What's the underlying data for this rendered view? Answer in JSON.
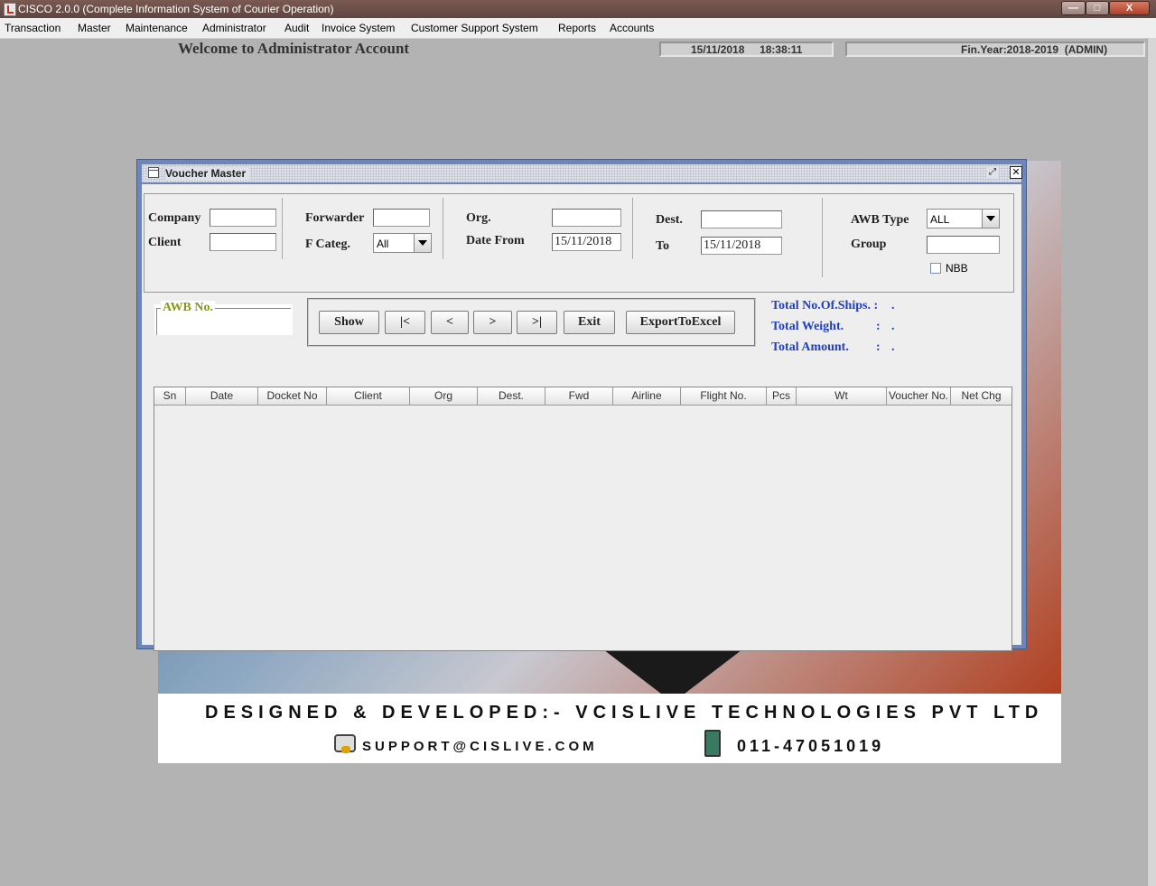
{
  "app": {
    "title": "CISCO 2.0.0 (Complete Information System of Courier Operation)",
    "window_controls": {
      "minimize": "—",
      "maximize": "□",
      "close": "X"
    }
  },
  "menu": [
    "Transaction",
    "Master",
    "Maintenance",
    "Administrator",
    "Audit",
    "Invoice System",
    "Customer Support System",
    "Reports",
    "Accounts"
  ],
  "header": {
    "welcome": "Welcome to Administrator Account",
    "datetime": "15/11/2018     18:38:11",
    "fin_year": "Fin.Year:2018-2019  (ADMIN)"
  },
  "poster": {
    "designed_by": "DESIGNED & DEVELOPED:- VCISLIVE TECHNOLOGIES PVT LTD",
    "support_email": "SUPPORT@CISLIVE.COM",
    "phone": "011-47051019"
  },
  "voucher": {
    "title": "Voucher Master",
    "labels": {
      "company": "Company",
      "client": "Client",
      "forwarder": "Forwarder",
      "f_categ": "F Categ.",
      "org": "Org.",
      "date_from": "Date From",
      "dest": "Dest.",
      "to": "To",
      "awb_type": "AWB Type",
      "group": "Group",
      "nbb": "NBB",
      "awb_no": "AWB No."
    },
    "values": {
      "company": "",
      "client": "",
      "forwarder": "",
      "f_categ": "All",
      "org": "",
      "date_from": "15/11/2018",
      "dest": "",
      "to": "15/11/2018",
      "awb_type": "ALL",
      "group": "",
      "awb_no": ""
    },
    "buttons": {
      "show": "Show",
      "first": "|<",
      "prev": "<",
      "next": ">",
      "last": ">|",
      "exit": "Exit",
      "export": "ExportToExcel"
    },
    "totals": {
      "ships_label": "Total No.Of.Ships. :",
      "ships_value": ".",
      "weight_label": "Total Weight.",
      "weight_value": ".",
      "amount_label": "Total Amount.",
      "amount_value": ".",
      "colon": ":"
    },
    "columns": [
      "Sn",
      "Date",
      "Docket No",
      "Client",
      "Org",
      "Dest.",
      "Fwd",
      "Airline",
      "Flight No.",
      "Pcs",
      "Wt",
      "Voucher No.",
      "Net Chg"
    ],
    "rows": []
  }
}
